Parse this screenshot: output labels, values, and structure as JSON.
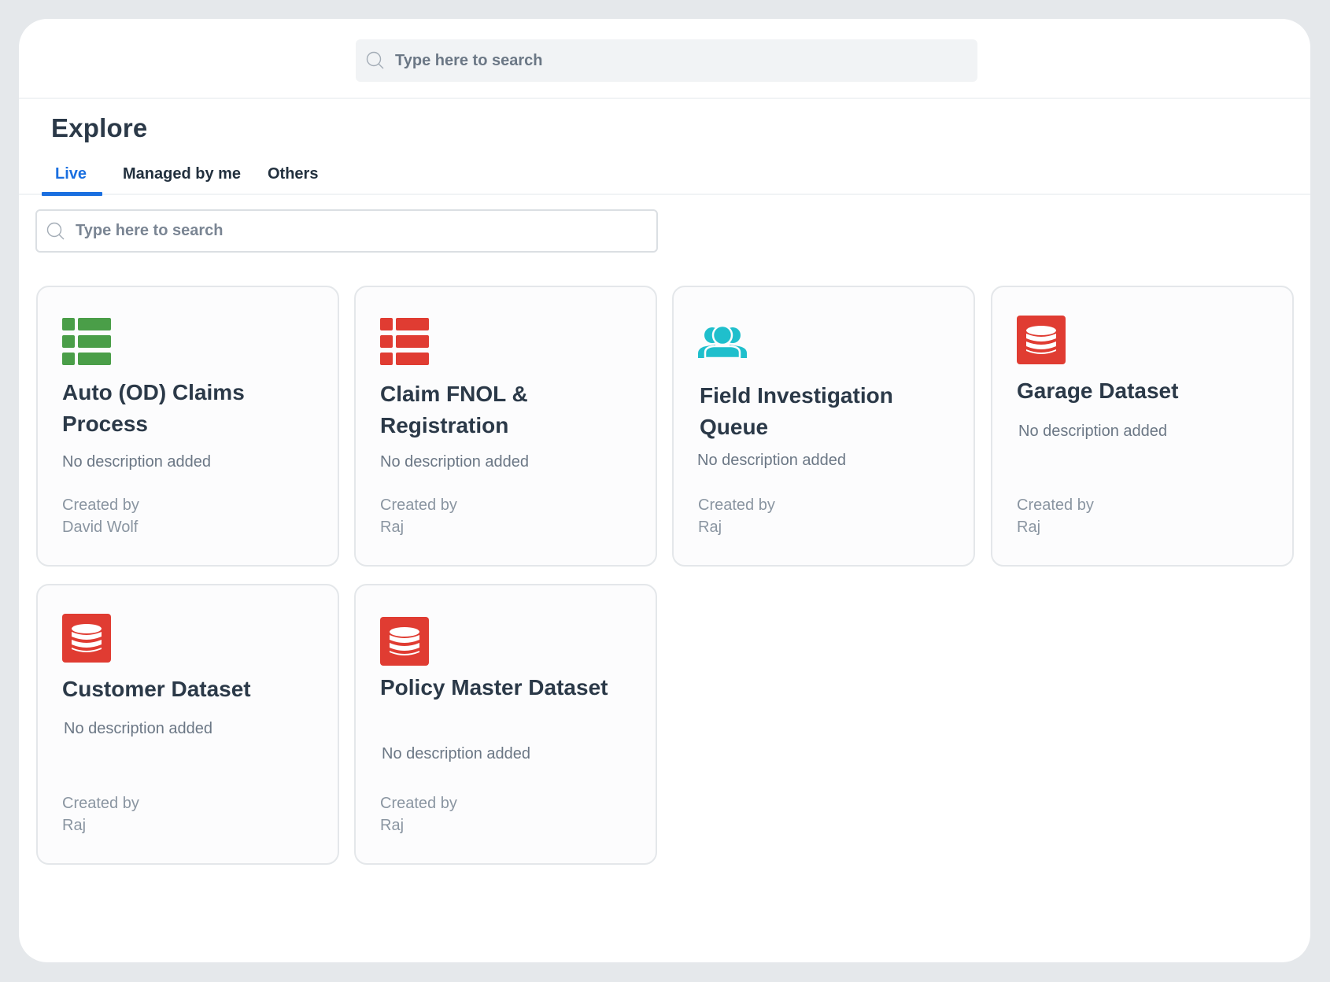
{
  "header": {
    "search_placeholder": "Type here to search",
    "search_icon": "search-icon"
  },
  "page": {
    "title": "Explore"
  },
  "tabs": [
    {
      "label": "Live",
      "active": true
    },
    {
      "label": "Managed by me",
      "active": false
    },
    {
      "label": "Others",
      "active": false
    }
  ],
  "filter": {
    "search_placeholder": "Type here to search",
    "search_icon": "search-icon"
  },
  "colors": {
    "accent": "#1a6fe0",
    "table_green": "#4a9e48",
    "table_red": "#e03c32",
    "users_teal": "#1fbfcc",
    "dataset_red": "#e03c32"
  },
  "cards": [
    {
      "title": "Auto (OD) Claims Process",
      "icon": "table-icon",
      "icon_color": "#4a9e48",
      "description": "No description added",
      "created_label": "Created by",
      "author": "David Wolf"
    },
    {
      "title": "Claim FNOL & Registration",
      "icon": "table-icon",
      "icon_color": "#e03c32",
      "description": "No description added",
      "created_label": "Created by",
      "author": "Raj"
    },
    {
      "title": "Field Investigation Queue",
      "icon": "users-icon",
      "icon_color": "#1fbfcc",
      "description": "No description added",
      "created_label": "Created by",
      "author": "Raj"
    },
    {
      "title": "Garage Dataset",
      "icon": "database-icon",
      "icon_color": "#e03c32",
      "description": "No description added",
      "created_label": "Created by",
      "author": "Raj"
    },
    {
      "title": "Customer Dataset",
      "icon": "database-icon",
      "icon_color": "#e03c32",
      "description": "No description added",
      "created_label": "Created by",
      "author": "Raj"
    },
    {
      "title": "Policy Master Dataset",
      "icon": "database-icon",
      "icon_color": "#e03c32",
      "description": "No description added",
      "created_label": "Created by",
      "author": "Raj"
    }
  ]
}
